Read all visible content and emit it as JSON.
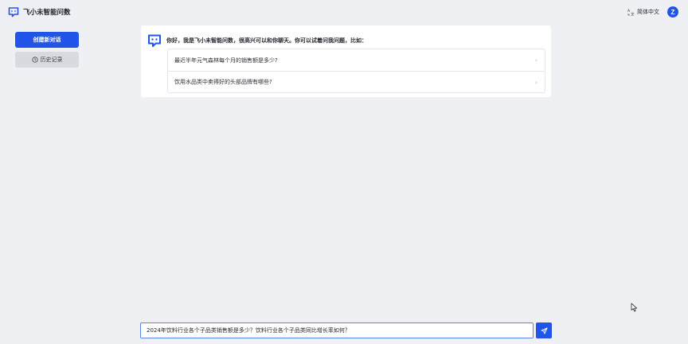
{
  "header": {
    "app_title": "飞小未智能问数",
    "language_label": "简体中文",
    "avatar_initial": "Z"
  },
  "sidebar": {
    "new_chat_label": "创建新对话",
    "history_label": "历史记录"
  },
  "welcome": {
    "greeting": "你好，我是飞小未智能问数，很高兴可以和你聊天。你可以试着问我问题，比如：",
    "suggestions": [
      {
        "text": "最近半年元气森林每个月的销售额是多少?"
      },
      {
        "text": "饮用水品类中卖得好的头部品牌有哪些?"
      }
    ]
  },
  "composer": {
    "value": "2024年饮料行业各个子品类销售额是多少？饮料行业各个子品类同比增长率如何？"
  },
  "colors": {
    "accent": "#2155ea",
    "background": "#eef0f4",
    "card": "#ffffff"
  },
  "icons": {
    "logo": "chat-bot-logo-icon",
    "language": "translate-icon",
    "history": "history-clock-icon",
    "chevron": "chevron-right-icon",
    "send": "send-icon",
    "cursor": "mouse-pointer-icon"
  }
}
